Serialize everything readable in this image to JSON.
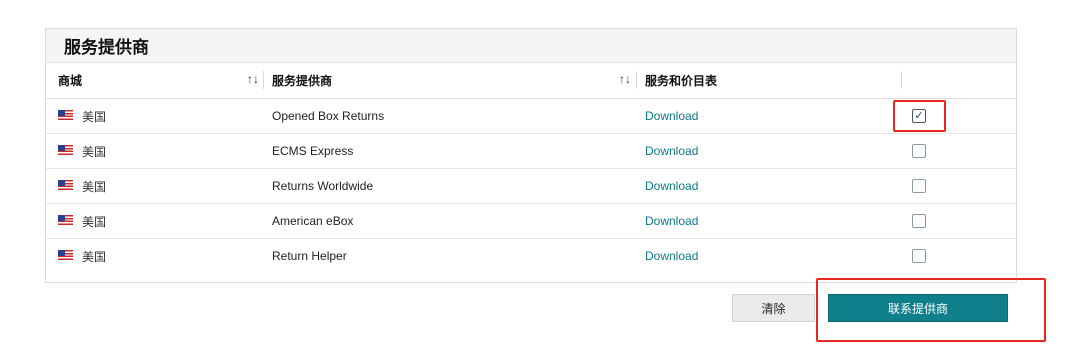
{
  "panel": {
    "title": "服务提供商"
  },
  "table": {
    "headers": {
      "marketplace": "商城",
      "provider": "服务提供商",
      "price_list": "服务和价目表"
    },
    "sort_icon": "↑↓",
    "rows": [
      {
        "flag": "us-flag-icon",
        "country": "美国",
        "provider": "Opened Box Returns",
        "link": "Download",
        "checked": true,
        "check_glyph": "✓"
      },
      {
        "flag": "us-flag-icon",
        "country": "美国",
        "provider": "ECMS Express",
        "link": "Download",
        "checked": false,
        "check_glyph": ""
      },
      {
        "flag": "us-flag-icon",
        "country": "美国",
        "provider": "Returns Worldwide",
        "link": "Download",
        "checked": false,
        "check_glyph": ""
      },
      {
        "flag": "us-flag-icon",
        "country": "美国",
        "provider": "American eBox",
        "link": "Download",
        "checked": false,
        "check_glyph": ""
      },
      {
        "flag": "us-flag-icon",
        "country": "美国",
        "provider": "Return Helper",
        "link": "Download",
        "checked": false,
        "check_glyph": ""
      }
    ]
  },
  "actions": {
    "clear_label": "清除",
    "contact_label": "联系提供商"
  },
  "colors": {
    "accent": "#0f7f8c",
    "link": "#0d7a8a",
    "highlight": "#e8281e"
  }
}
